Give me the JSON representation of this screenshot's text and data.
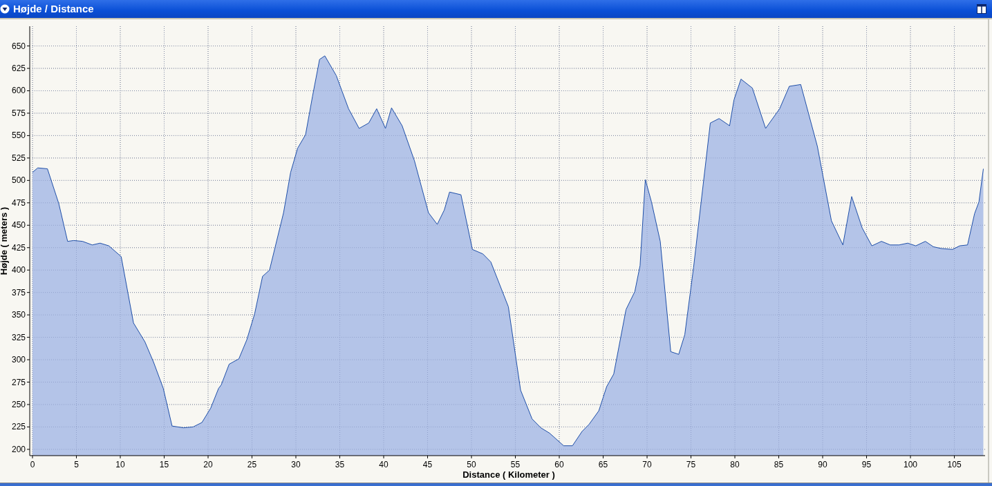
{
  "panel": {
    "title": "Højde / Distance"
  },
  "chart": {
    "chart_data": {
      "type": "area",
      "xlabel": "Distance ( Kilometer )",
      "ylabel": "Højde ( meters )",
      "xlim": [
        0,
        108.5
      ],
      "ylim": [
        193,
        672
      ],
      "xticks": [
        0,
        5,
        10,
        15,
        20,
        25,
        30,
        35,
        40,
        45,
        50,
        55,
        60,
        65,
        70,
        75,
        80,
        85,
        90,
        95,
        100,
        105
      ],
      "yticks": [
        200,
        225,
        250,
        275,
        300,
        325,
        350,
        375,
        400,
        425,
        450,
        475,
        500,
        525,
        550,
        575,
        600,
        625,
        650
      ],
      "x": [
        0,
        0.6,
        1.7,
        3,
        4,
        4.7,
        5.7,
        6.8,
        7.7,
        8.7,
        10.1,
        11.5,
        12.8,
        13.8,
        14.9,
        15.9,
        17.2,
        18.3,
        19.3,
        20.3,
        21.2,
        21.5,
        22.4,
        23.5,
        24.4,
        25.3,
        26.2,
        27,
        28.6,
        29.4,
        30.2,
        31.1,
        31.9,
        32.7,
        33.3,
        34.6,
        36,
        37.2,
        38.3,
        39.2,
        40.2,
        40.9,
        42.1,
        43.5,
        45.1,
        46.1,
        46.9,
        47.5,
        48.8,
        50.1,
        51.3,
        52.2,
        54.2,
        55.6,
        56.9,
        57.9,
        58.9,
        60.5,
        61.5,
        62.6,
        63.4,
        64.5,
        65.4,
        66.2,
        67.6,
        68.6,
        69.2,
        69.8,
        70.5,
        71.5,
        72.7,
        73.6,
        74.3,
        75.3,
        77.2,
        78.2,
        79.4,
        79.9,
        80.7,
        82,
        83.5,
        85.1,
        86.2,
        87.5,
        89.4,
        91,
        92.3,
        93.3,
        94.5,
        95.6,
        96.7,
        97.7,
        98.7,
        99.7,
        100.6,
        101.7,
        102.6,
        103.5,
        104.8,
        105.6,
        106.5,
        107.3,
        107.8,
        108.3
      ],
      "grid": true,
      "series": [
        {
          "color": "#b4c4e8",
          "values": [
            509,
            514,
            513,
            474,
            432,
            433,
            432,
            428,
            430,
            427,
            415,
            341,
            320,
            297,
            268,
            226,
            224,
            225,
            230,
            246,
            268,
            272,
            295,
            301,
            322,
            351,
            393,
            400,
            464,
            509,
            536,
            551,
            594,
            635,
            639,
            617,
            580,
            558,
            564,
            580,
            558,
            581,
            561,
            522,
            464,
            451,
            467,
            487,
            484,
            423,
            418,
            409,
            359,
            266,
            234,
            224,
            218,
            204,
            204,
            220,
            228,
            243,
            270,
            284,
            356,
            376,
            405,
            501,
            476,
            432,
            309,
            306,
            328,
            403,
            564,
            569,
            561,
            590,
            613,
            603,
            558,
            580,
            605,
            607,
            538,
            455,
            428,
            482,
            447,
            427,
            432,
            428,
            428,
            430,
            427,
            432,
            426,
            424,
            423,
            427,
            428,
            463,
            476,
            513
          ]
        }
      ]
    }
  }
}
